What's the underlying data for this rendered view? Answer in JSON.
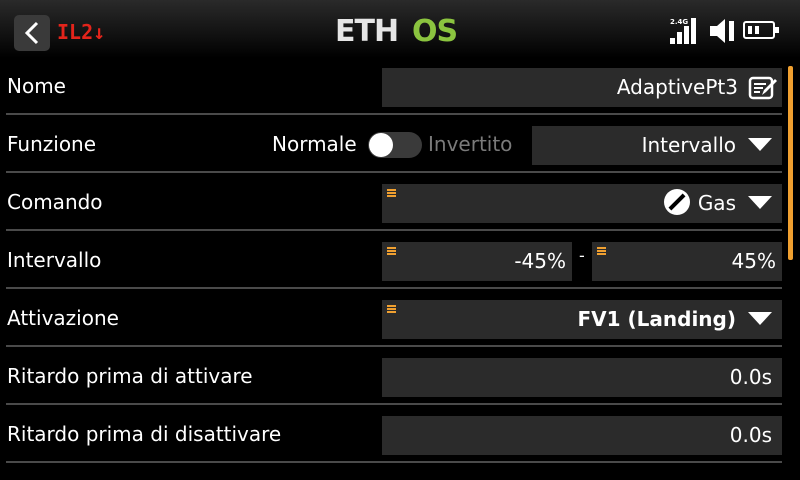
{
  "header": {
    "model_tag": "IL2↓",
    "logo_text": "ETHOS",
    "rf_label": "2.4G",
    "icons": [
      "back-chevron-icon",
      "signal-bars-icon",
      "speaker-icon",
      "battery-icon"
    ]
  },
  "rows": {
    "nome": {
      "label": "Nome",
      "value": "AdaptivePt3",
      "icon": "edit-icon"
    },
    "funzione": {
      "label": "Funzione",
      "toggle_on_label": "Normale",
      "toggle_off_label": "Invertito",
      "toggle_state": "off",
      "value": "Intervallo"
    },
    "comando": {
      "label": "Comando",
      "value": "Gas",
      "icon": "throttle-gas-icon"
    },
    "intervallo": {
      "label": "Intervallo",
      "min": "-45%",
      "separator": "-",
      "max": "45%"
    },
    "attivazione": {
      "label": "Attivazione",
      "value": "FV1 (Landing)"
    },
    "ritardo_attivare": {
      "label": "Ritardo prima di attivare",
      "value": "0.0s"
    },
    "ritardo_disattivare": {
      "label": "Ritardo prima di disattivare",
      "value": "0.0s"
    }
  },
  "colors": {
    "accent": "#f0a030",
    "model_tag": "#e3241b",
    "logo_green": "#8bc43f",
    "field_bg": "#2b2b2b",
    "background": "#000000"
  }
}
